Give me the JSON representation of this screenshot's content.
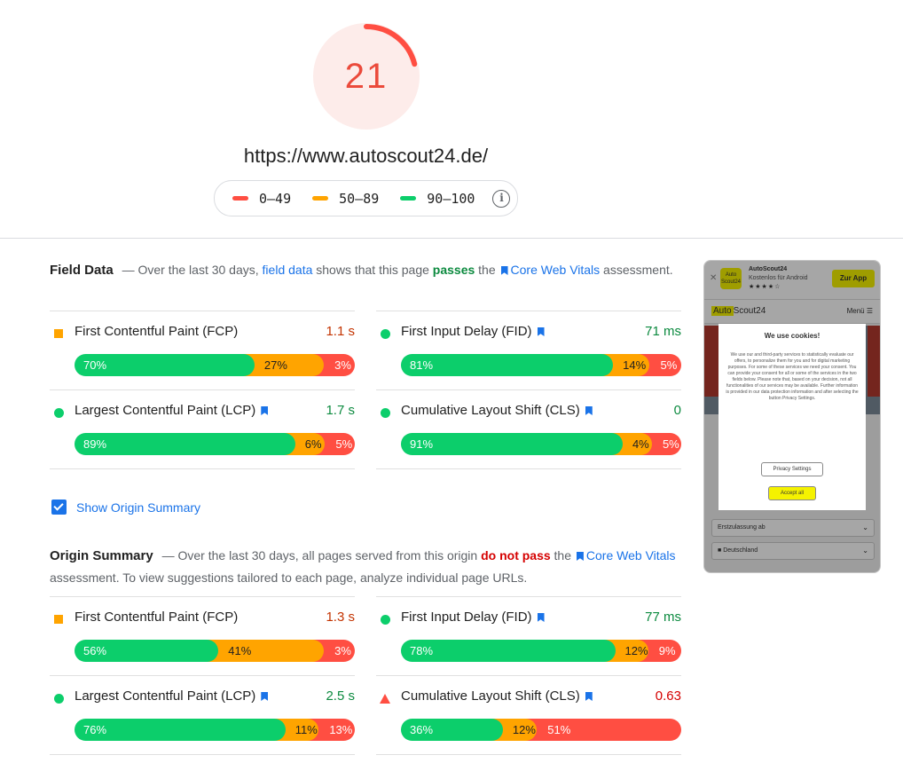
{
  "header": {
    "score": "21",
    "score_fraction": 0.21,
    "score_color": "#eb4a3b",
    "url": "https://www.autoscout24.de/",
    "legend": [
      {
        "label": "0–49",
        "color": "#ff4e42"
      },
      {
        "label": "50–89",
        "color": "#ffa400"
      },
      {
        "label": "90–100",
        "color": "#0cce6b"
      }
    ],
    "info_icon": "info-icon"
  },
  "field_data": {
    "title": "Field Data",
    "desc": {
      "dash": "—",
      "pre": " Over the last 30 days, ",
      "link": "field data",
      "mid": " shows that this page ",
      "status": "passes",
      "the": " the ",
      "cwv": "Core Web Vitals",
      "post": " assessment."
    },
    "metrics": [
      {
        "name": "First Contentful Paint (FCP)",
        "value": "1.1 s",
        "rating": "avg",
        "icon": "square",
        "bookmark": false,
        "dist": [
          70,
          27,
          3
        ],
        "labels": [
          "70%",
          "27%",
          "3%"
        ]
      },
      {
        "name": "First Input Delay (FID)",
        "value": "71 ms",
        "rating": "good",
        "icon": "circle",
        "bookmark": true,
        "dist": [
          81,
          14,
          5
        ],
        "labels": [
          "81%",
          "14%",
          "5%"
        ]
      },
      {
        "name": "Largest Contentful Paint (LCP)",
        "value": "1.7 s",
        "rating": "good",
        "icon": "circle",
        "bookmark": true,
        "dist": [
          89,
          6,
          5
        ],
        "labels": [
          "89%",
          "6%",
          "5%"
        ]
      },
      {
        "name": "Cumulative Layout Shift (CLS)",
        "value": "0",
        "rating": "good",
        "icon": "circle",
        "bookmark": true,
        "dist": [
          91,
          4,
          5
        ],
        "labels": [
          "91%",
          "4%",
          "5%"
        ]
      }
    ]
  },
  "origin_toggle": {
    "label": "Show Origin Summary",
    "checked": true
  },
  "origin_summary": {
    "title": "Origin Summary",
    "desc": {
      "dash": "—",
      "pre": " Over the last 30 days, all pages served from this origin ",
      "status": "do not pass",
      "the": " the ",
      "cwv": "Core Web Vitals",
      "post": " assessment. To view suggestions tailored to each page, analyze individual page URLs."
    },
    "metrics": [
      {
        "name": "First Contentful Paint (FCP)",
        "value": "1.3 s",
        "rating": "avg",
        "icon": "square",
        "bookmark": false,
        "dist": [
          56,
          41,
          3
        ],
        "labels": [
          "56%",
          "41%",
          "3%"
        ]
      },
      {
        "name": "First Input Delay (FID)",
        "value": "77 ms",
        "rating": "good",
        "icon": "circle",
        "bookmark": true,
        "dist": [
          78,
          12,
          9
        ],
        "labels": [
          "78%",
          "12%",
          "9%"
        ]
      },
      {
        "name": "Largest Contentful Paint (LCP)",
        "value": "2.5 s",
        "rating": "good",
        "icon": "circle",
        "bookmark": true,
        "dist": [
          76,
          11,
          13
        ],
        "labels": [
          "76%",
          "11%",
          "13%"
        ]
      },
      {
        "name": "Cumulative Layout Shift (CLS)",
        "value": "0.63",
        "rating": "poor",
        "icon": "triangle",
        "bookmark": true,
        "dist": [
          36,
          12,
          51
        ],
        "labels": [
          "36%",
          "12%",
          "51%"
        ]
      }
    ]
  },
  "screenshot": {
    "app_icon_text": "Auto Scout24",
    "app_name": "AutoScout24",
    "app_sub": "Kostenlos für Android",
    "stars": "★★★★☆",
    "app_button": "Zur App",
    "logo_a": "Auto",
    "logo_b": "Scout24",
    "menu": "Menü ☰",
    "dialog_title": "We use cookies!",
    "dialog_text": "We use our and third-party services to statistically evaluate our offers, to personalize them for you and for digital marketing purposes. For some of these services we need your consent. You can provide your consent for all or some of the services in the two fields below. Please note that, based on your decision, not all functionalities of our services may be available. Further information is provided in our data protection information and after selecting the button Privacy Settings.",
    "privacy_settings": "Privacy Settings",
    "accept_all": "Accept all",
    "field_1": "Erstzulassung ab",
    "field_2": "Deutschland"
  }
}
